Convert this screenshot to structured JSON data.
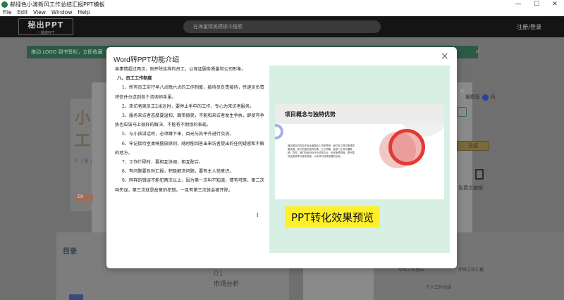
{
  "window": {
    "title": "邮绿色小清新风工作总结汇报PPT模板",
    "minimize": "—",
    "maximize": "☐",
    "close": "✕"
  },
  "menu": [
    "File",
    "Edit",
    "View",
    "Window",
    "Help"
  ],
  "header": {
    "logo_main": "秘出PPT",
    "logo_sub": "一键做PPT",
    "search_placeholder": "在海量精美模板中搜索",
    "login": "注册/登录"
  },
  "notice": {
    "text": "拖动 LOGO 到书签栏，立即收藏",
    "close": "✕"
  },
  "background": {
    "big_a": "小",
    "big_b": "工",
    "small": "个 | 第 |",
    "ex": "EX",
    "right_label": "播模板",
    "right_suffix": "色",
    "btn2": "方式",
    "btn3": "免费文编辑",
    "menu_text": "目录",
    "num": "01",
    "market": "市场分析",
    "side_a": "个人工作总结",
    "side_b": "个人工作总结",
    "small_r1": "年终工作总结",
    "small_r2": "年终工作汇报"
  },
  "modal": {
    "title": "Word转PPT功能介绍",
    "close": "×",
    "document": [
      {
        "type": "first",
        "text": "类事情超过两次，则开除这样的员工，以保证服务质量和公司形象。"
      },
      {
        "type": "heading",
        "text": "八、员工工作制度"
      },
      {
        "type": "para",
        "text": "1、所有员工实行早八点晚六点的工作制度，接待员负责接待，传递员负责将信件分送到各个咨询师手里。"
      },
      {
        "type": "para",
        "text": "2、来访者离员工2米远时，要停止手中的工作，专心为来访者服务。"
      },
      {
        "type": "para",
        "text": "3、服务来访者态度要温和，面带微笑，不能和来访者发生争执，即使有争执也应该马上很好的解决，不能有不耐烦的表现。"
      },
      {
        "type": "para",
        "text": "5、与小孩讲话时，必须蹲下来，目光与其平齐进行交流。"
      },
      {
        "type": "para",
        "text": "6、牢记接待室桌椅摆放原则，随时能回答出来访者提出的任何疑惑和不解的地方。"
      },
      {
        "type": "para",
        "text": "7、工作忙碌时，要相互协调，相互配合。"
      },
      {
        "type": "para",
        "text": "8、有问题要及时汇报，积极解决问题，要有主人翁意识。"
      },
      {
        "type": "para",
        "text": "9、同样的错误不能犯两次以上，因为第一次叫不知道，情有可原。第二次叫失误，第三次就是故意的犯错。一旦有第三次就会被开除。"
      }
    ],
    "preview": {
      "slide_title": "项目概念与独特优势",
      "slide_text": "通过团队协同合作及全面整合人员和物资，我们在工程中取得显著进展。我们的团队结构完善，分工明确，各部门之间沟通顺畅。同时，我们持续对标行业领先企业，优化管理流程，提升整体运营效率与服务质量，以实现可持续发展的目标。",
      "caption": "PPT转化效果预览"
    }
  },
  "colors": {
    "preview_bg": "#d8efe4",
    "caption_bg": "#fff02a",
    "ring": "#e43a34",
    "header_bg": "#141414"
  }
}
